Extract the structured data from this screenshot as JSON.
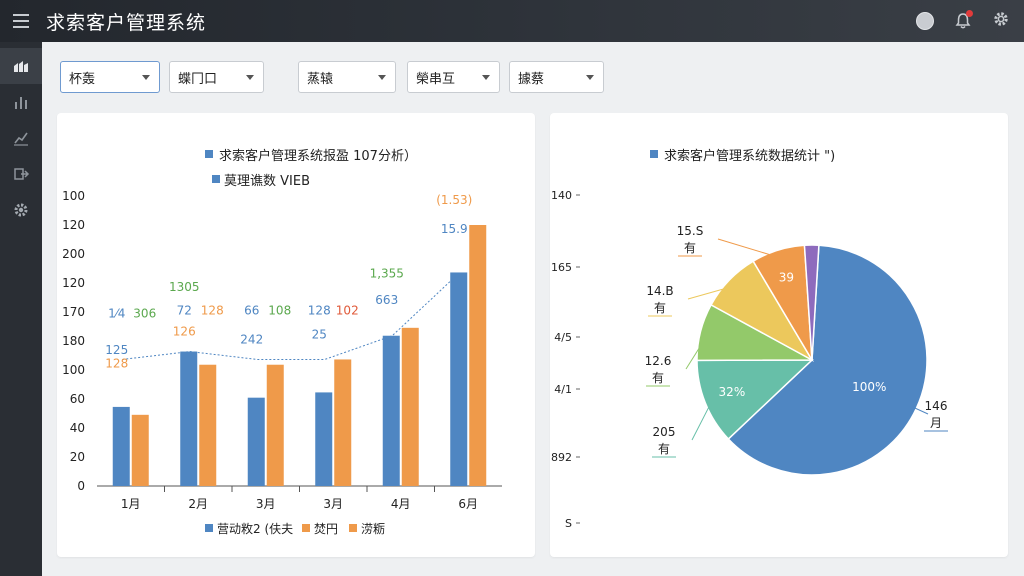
{
  "app": {
    "title": "求索客户管理系统"
  },
  "filters": [
    {
      "label": "杯轰"
    },
    {
      "label": "蝶冂口"
    },
    {
      "label": "蒸辕"
    },
    {
      "label": "榮串互"
    },
    {
      "label": "據蔡"
    }
  ],
  "colors": {
    "blue": "#4f86c2",
    "orange": "#ef9a4a",
    "green": "#5ba84e",
    "red": "#e05a3a",
    "header": "#2c3138",
    "sidebar": "#2a2e34"
  },
  "sidebar": {
    "icons": [
      "dashboard-icon",
      "bar-chart-icon",
      "trend-icon",
      "export-icon",
      "settings-icon"
    ]
  },
  "bar_card": {
    "chart_data": {
      "type": "bar",
      "title": "求索客户管理系统报盈 107分析）",
      "subtitle": "莫理谯数 VIEB",
      "categories": [
        "1月",
        "2月",
        "3月",
        "3月",
        "4月",
        "6月"
      ],
      "yticks": [
        "100",
        "120",
        "200",
        "120",
        "170",
        "180",
        "100",
        "60",
        "40",
        "20",
        "0"
      ],
      "series": [
        {
          "name": "营动敉2 (伕夫",
          "values": [
            60,
            102,
            67,
            71,
            114,
            162
          ]
        },
        {
          "name": "焚円",
          "values": [
            54,
            92,
            92,
            96,
            120,
            198
          ]
        }
      ],
      "legend": [
        "营动敉2 (伕夫",
        "焚円",
        "涝粝"
      ],
      "annotations": [
        {
          "text": "1⁄4",
          "category": 0,
          "y": 128,
          "color": "blue"
        },
        {
          "text": "306",
          "category": 0,
          "y": 128,
          "color": "green"
        },
        {
          "text": "125",
          "category": 0,
          "y": 100,
          "color": "blue"
        },
        {
          "text": "128",
          "category": 0,
          "y": 90,
          "color": "orange"
        },
        {
          "text": "1305",
          "category": 1,
          "y": 148,
          "color": "green"
        },
        {
          "text": "72",
          "category": 1,
          "y": 130,
          "color": "blue"
        },
        {
          "text": "128",
          "category": 1,
          "y": 130,
          "color": "orange"
        },
        {
          "text": "126",
          "category": 1,
          "y": 114,
          "color": "orange"
        },
        {
          "text": "66",
          "category": 2,
          "y": 130,
          "color": "blue"
        },
        {
          "text": "108",
          "category": 2,
          "y": 130,
          "color": "green"
        },
        {
          "text": "242",
          "category": 2,
          "y": 108,
          "color": "blue"
        },
        {
          "text": "128",
          "category": 3,
          "y": 130,
          "color": "blue"
        },
        {
          "text": "102",
          "category": 3,
          "y": 130,
          "color": "red"
        },
        {
          "text": "25",
          "category": 3,
          "y": 112,
          "color": "blue"
        },
        {
          "text": "663",
          "category": 4,
          "y": 138,
          "color": "blue"
        },
        {
          "text": "1,355",
          "category": 4,
          "y": 158,
          "color": "green"
        },
        {
          "text": "15.9",
          "category": 5,
          "y": 192,
          "color": "blue"
        },
        {
          "text": "(1.53)",
          "category": 5,
          "y": 214,
          "color": "orange"
        }
      ]
    }
  },
  "pie_card": {
    "chart_data": {
      "type": "pie",
      "title": "求索客户管理系统数据统计 \")",
      "yticks": [
        "140",
        "165",
        "4/5",
        "4/1",
        "892",
        "S"
      ],
      "slices": [
        {
          "label": "100%",
          "value": 62,
          "color": "#4f86c2"
        },
        {
          "label": "32%",
          "value": 12,
          "color": "#67bfa8"
        },
        {
          "label": "",
          "value": 8,
          "color": "#93c96a"
        },
        {
          "label": "",
          "value": 8.5,
          "color": "#ecc85c"
        },
        {
          "label": "39",
          "value": 7.5,
          "color": "#ef9a4a"
        },
        {
          "label": "",
          "value": 2,
          "color": "#8e6bbd"
        }
      ],
      "callouts": [
        {
          "value": "15.S",
          "unit": "有"
        },
        {
          "value": "14.B",
          "unit": "有"
        },
        {
          "value": "12.6",
          "unit": "有"
        },
        {
          "value": "205",
          "unit": "有"
        },
        {
          "value": "146",
          "unit": "月"
        }
      ]
    }
  }
}
